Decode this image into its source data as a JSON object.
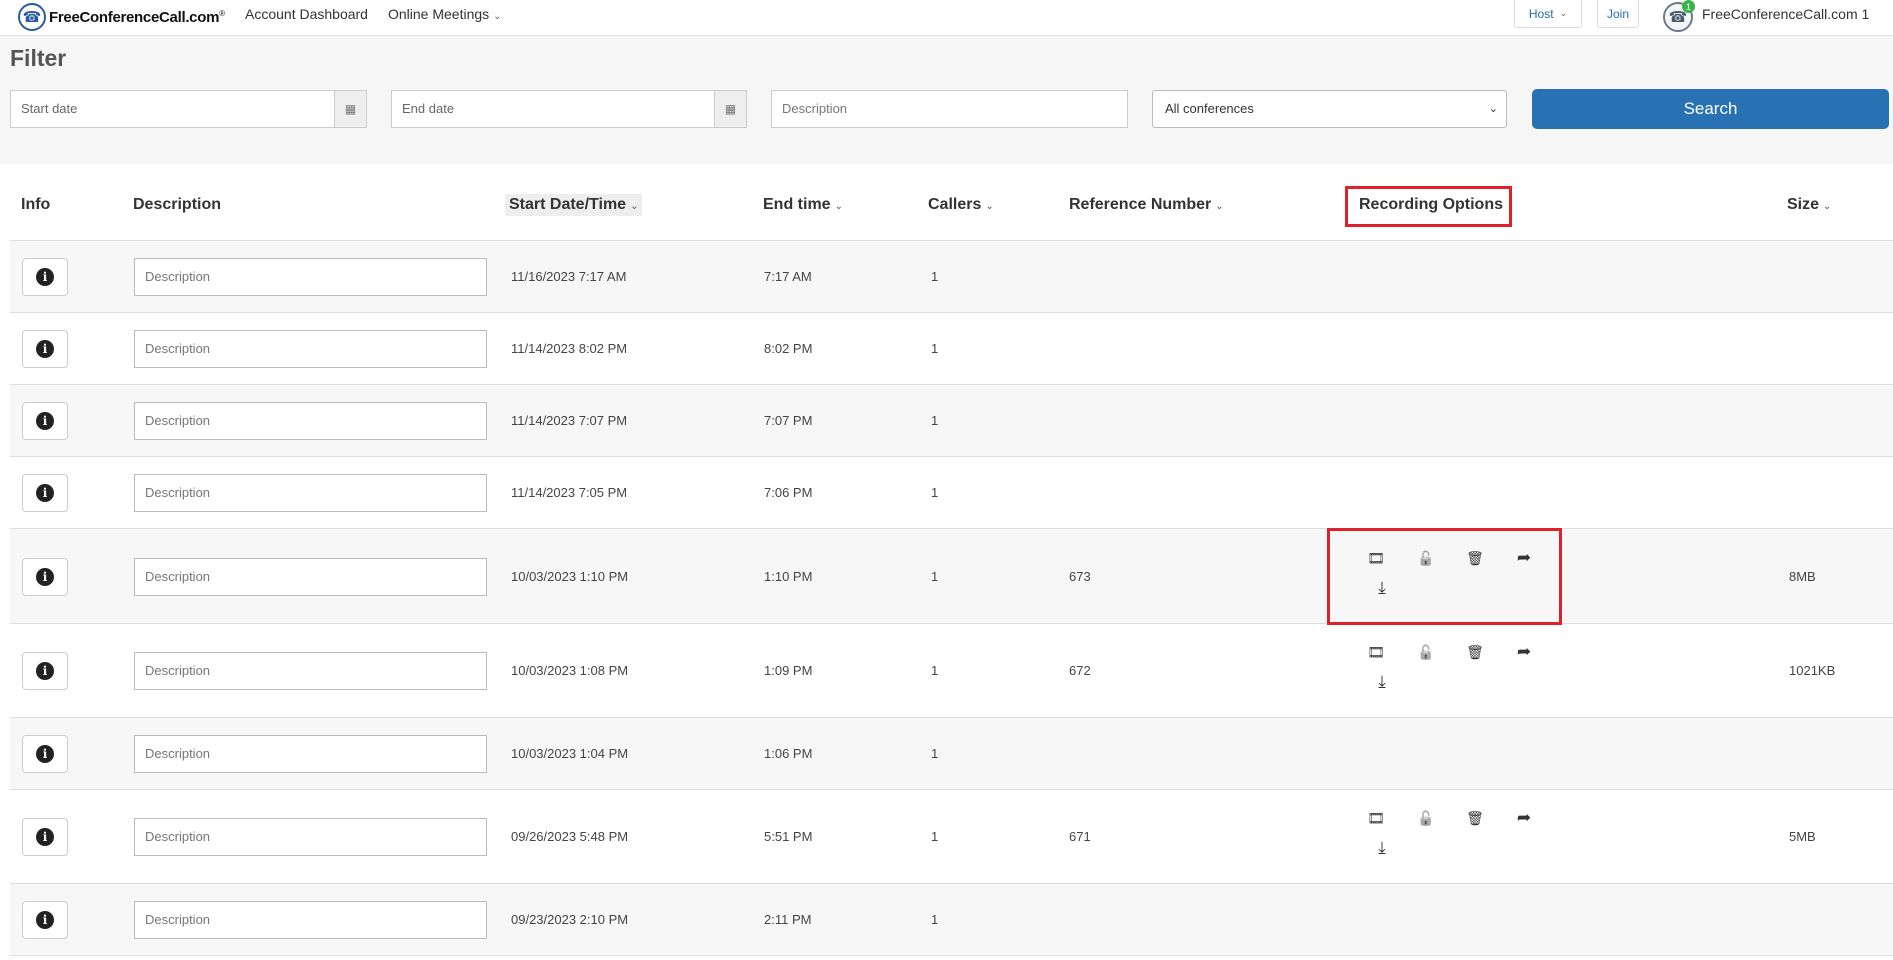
{
  "nav": {
    "logo_text": "FreeConferenceCall.com",
    "logo_mark": "®",
    "links": [
      "Account Dashboard",
      "Online Meetings"
    ],
    "host_label": "Host",
    "join_label": "Join",
    "account_badge": "1",
    "account_name": "FreeConferenceCall.com 1"
  },
  "filter": {
    "title": "Filter",
    "start_placeholder": "Start date",
    "end_placeholder": "End date",
    "description_placeholder": "Description",
    "conference_selected": "All conferences",
    "search_label": "Search"
  },
  "table": {
    "headers": {
      "info": "Info",
      "description": "Description",
      "start": "Start Date/Time",
      "end": "End time",
      "callers": "Callers",
      "reference": "Reference Number",
      "recording": "Recording Options",
      "size": "Size"
    },
    "description_placeholder": "Description",
    "rows": [
      {
        "start": "11/16/2023 7:17 AM",
        "end": "7:17 AM",
        "callers": "1",
        "reference": "",
        "size": "",
        "has_recording": false
      },
      {
        "start": "11/14/2023 8:02 PM",
        "end": "8:02 PM",
        "callers": "1",
        "reference": "",
        "size": "",
        "has_recording": false
      },
      {
        "start": "11/14/2023 7:07 PM",
        "end": "7:07 PM",
        "callers": "1",
        "reference": "",
        "size": "",
        "has_recording": false
      },
      {
        "start": "11/14/2023 7:05 PM",
        "end": "7:06 PM",
        "callers": "1",
        "reference": "",
        "size": "",
        "has_recording": false
      },
      {
        "start": "10/03/2023 1:10 PM",
        "end": "1:10 PM",
        "callers": "1",
        "reference": "673",
        "size": "8MB",
        "has_recording": true
      },
      {
        "start": "10/03/2023 1:08 PM",
        "end": "1:09 PM",
        "callers": "1",
        "reference": "672",
        "size": "1021KB",
        "has_recording": true
      },
      {
        "start": "10/03/2023 1:04 PM",
        "end": "1:06 PM",
        "callers": "1",
        "reference": "",
        "size": "",
        "has_recording": false
      },
      {
        "start": "09/26/2023 5:48 PM",
        "end": "5:51 PM",
        "callers": "1",
        "reference": "671",
        "size": "5MB",
        "has_recording": true
      },
      {
        "start": "09/23/2023 2:10 PM",
        "end": "2:11 PM",
        "callers": "1",
        "reference": "",
        "size": "",
        "has_recording": false
      }
    ]
  },
  "icons": {
    "info": "info-icon",
    "calendar": "calendar-icon",
    "recording": [
      "film-icon",
      "unlock-icon",
      "trash-icon",
      "share-icon",
      "download-icon"
    ]
  },
  "colors": {
    "accent": "#2872b4",
    "highlight": "#e0202a"
  }
}
